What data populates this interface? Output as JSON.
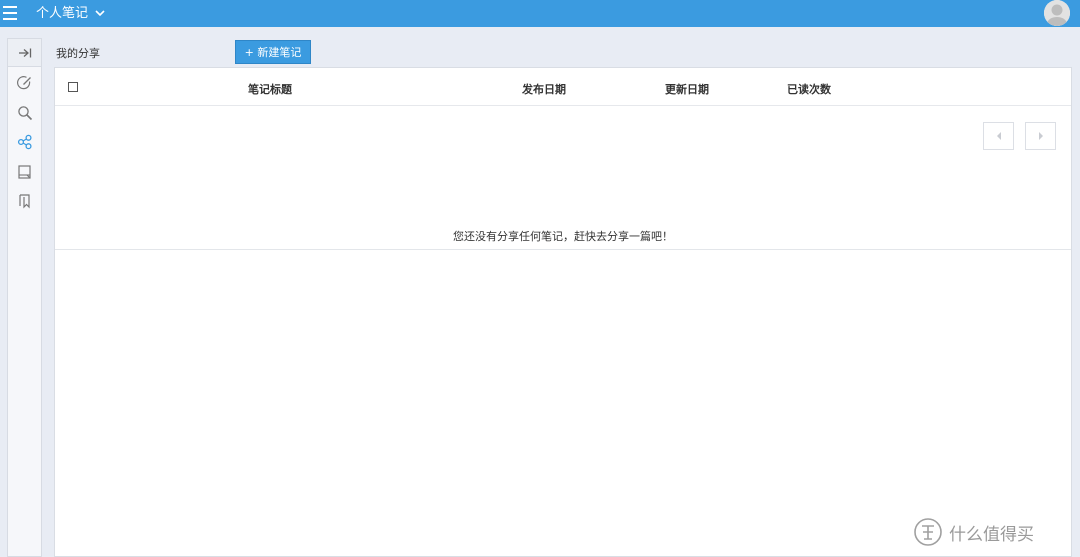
{
  "topbar": {
    "app_title": "个人笔记",
    "menu_icon": "hamburger-icon",
    "dropdown_icon": "chevron-down-icon",
    "avatar_icon": "user-avatar-icon",
    "color": "#3b9be0"
  },
  "sidebar": {
    "items": [
      {
        "icon": "collapse-arrow-icon",
        "active": false
      },
      {
        "icon": "edit-note-icon",
        "active": false
      },
      {
        "icon": "search-icon",
        "active": false
      },
      {
        "icon": "share-icon",
        "active": true
      },
      {
        "icon": "notebook-icon",
        "active": false
      },
      {
        "icon": "bookmark-icon",
        "active": false
      }
    ],
    "active_color": "#3b9be0"
  },
  "main": {
    "section_label": "我的分享",
    "new_note_button": "+ 新建笔记",
    "table": {
      "columns": [
        "笔记标题",
        "发布日期",
        "更新日期",
        "已读次数"
      ]
    },
    "empty_message": "您还没有分享任何笔记，赶快去分享一篇吧！",
    "pager": {
      "prev_icon": "prev-arrow-icon",
      "next_icon": "next-arrow-icon"
    }
  },
  "watermark": {
    "text": "什么值得买",
    "logo": "seal-logo"
  }
}
